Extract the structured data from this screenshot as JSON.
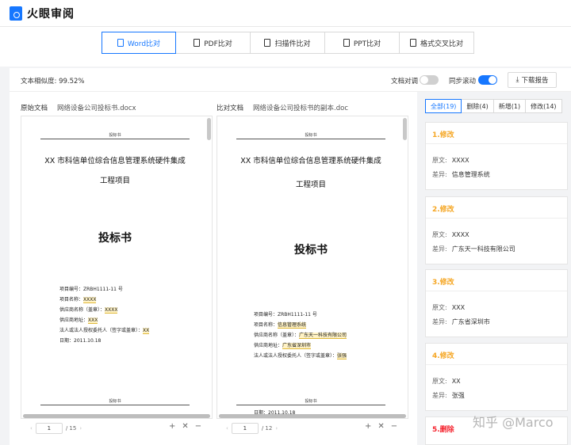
{
  "app": {
    "name": "火眼审阅"
  },
  "tabs": [
    {
      "label": "Word比对",
      "active": true
    },
    {
      "label": "PDF比对",
      "active": false
    },
    {
      "label": "扫描件比对",
      "active": false
    },
    {
      "label": "PPT比对",
      "active": false
    },
    {
      "label": "格式交叉比对",
      "active": false
    }
  ],
  "toolbar": {
    "similarity_label": "文本相似度:",
    "similarity_value": "99.52%",
    "doc_align_label": "文档对调",
    "doc_align_on": false,
    "sync_scroll_label": "同步滚动",
    "sync_scroll_on": true,
    "download_label": "下载报告"
  },
  "left": {
    "head_label": "原始文档",
    "file_name": "网络设备公司投标书.docx",
    "page_header": "投标书",
    "title_line1": "XX 市科信单位综合信息管理系统硬件集成",
    "title_line2": "工程项目",
    "big_title": "投标书",
    "fields": [
      {
        "label": "项目编号：ZRBH1111-11 号",
        "value": ""
      },
      {
        "label": "项目名称：",
        "value": "XXXX"
      },
      {
        "label": "供应商名称（盖章）：",
        "value": "XXXX"
      },
      {
        "label": "供应商地址：",
        "value": "XXX"
      },
      {
        "label": "法人或法人授权委托人（签字或盖章）：",
        "value": "XX"
      },
      {
        "label": "日期：2011.10.18",
        "value": ""
      }
    ],
    "footer_header": "投标书",
    "page_current": "1",
    "page_total": "/ 15"
  },
  "right": {
    "head_label": "比对文档",
    "file_name": "网络设备公司投标书的副本.doc",
    "page_header": "投标书",
    "title_line1": "XX 市科信单位综合信息管理系统硬件集成",
    "title_line2": "工程项目",
    "big_title": "投标书",
    "fields": [
      {
        "label": "项目编号：ZRBH1111-11 号",
        "value": ""
      },
      {
        "label": "项目名称：",
        "value": "信息管理系统"
      },
      {
        "label": "供应商名称（盖章）：",
        "value": "广东天一科技有限公司"
      },
      {
        "label": "供应商地址：",
        "value": "广东省深圳市"
      },
      {
        "label": "法人或法人授权委托人（签字或盖章）：",
        "value": "张强"
      }
    ],
    "footer_header": "投标书",
    "footer_date": "日期：2011.10.18",
    "page_current": "1",
    "page_total": "/ 12"
  },
  "zoom_icons": [
    "zoom-in-icon",
    "fit-icon",
    "zoom-out-icon"
  ],
  "diff_filters": [
    {
      "label": "全部(19)",
      "active": true
    },
    {
      "label": "删除(4)",
      "active": false
    },
    {
      "label": "新增(1)",
      "active": false
    },
    {
      "label": "修改(14)",
      "active": false
    }
  ],
  "diff_labels": {
    "original": "原文:",
    "difference": "差异:"
  },
  "diffs": [
    {
      "title": "1.修改",
      "type": "modify",
      "original": "XXXX",
      "difference": "信息管理系统"
    },
    {
      "title": "2.修改",
      "type": "modify",
      "original": "XXXX",
      "difference": "广东天一科技有限公司"
    },
    {
      "title": "3.修改",
      "type": "modify",
      "original": "XXX",
      "difference": "广东省深圳市"
    },
    {
      "title": "4.修改",
      "type": "modify",
      "original": "XX",
      "difference": "张强"
    },
    {
      "title": "5.删除",
      "type": "delete"
    }
  ],
  "watermark": "知乎 @Marco",
  "colors": {
    "accent": "#1677ff",
    "modify": "#f5a623",
    "delete": "#f5222d",
    "highlight": "#fff2c4"
  }
}
